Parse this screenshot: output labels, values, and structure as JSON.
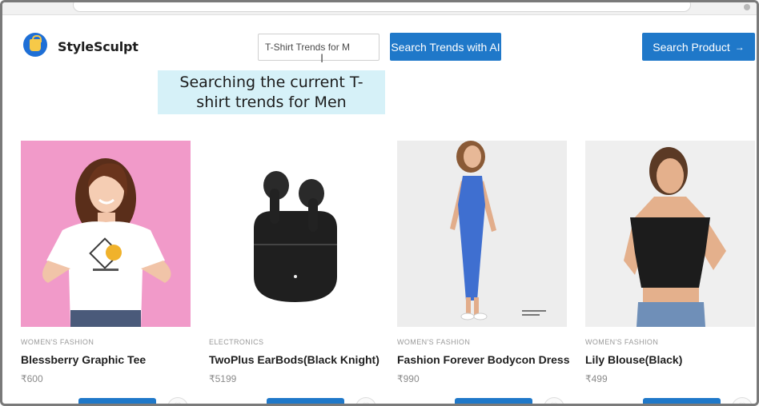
{
  "app": {
    "brand": "StyleSculpt"
  },
  "search": {
    "value": "T-Shirt Trends for M",
    "ai_button": "Search Trends with AI",
    "product_button": "Search Product",
    "product_button_icon": "arrow-right-icon"
  },
  "caption": {
    "line1": "Searching the current T-",
    "line2": "shirt trends for Men"
  },
  "colors": {
    "primary": "#1f78c9",
    "caption_bg": "#d6f1f8"
  },
  "products": [
    {
      "category": "WOMEN'S FASHION",
      "name": "Blessberry Graphic Tee",
      "price": "₹600",
      "image": "woman-white-graphic-tee-pink-backdrop"
    },
    {
      "category": "ELECTRONICS",
      "name": "TwoPlus EarBods(Black Knight)",
      "price": "₹5199",
      "image": "black-wireless-earbuds-case"
    },
    {
      "category": "WOMEN'S FASHION",
      "name": "Fashion Forever Bodycon Dress",
      "price": "₹990",
      "image": "woman-blue-bodycon-dress"
    },
    {
      "category": "WOMEN'S FASHION",
      "name": "Lily Blouse(Black)",
      "price": "₹499",
      "image": "woman-black-crop-blouse"
    }
  ]
}
